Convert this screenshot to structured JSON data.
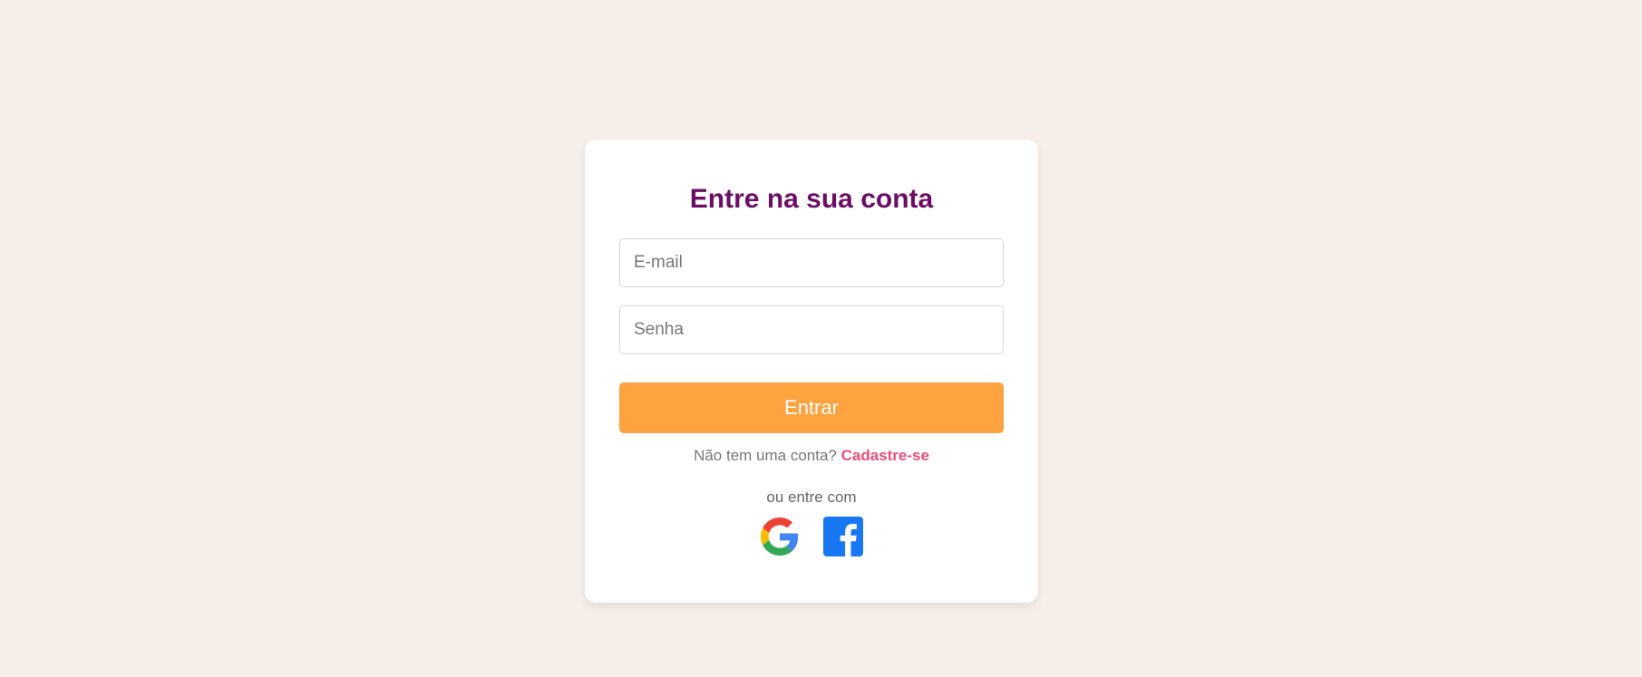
{
  "login": {
    "title": "Entre na sua conta",
    "email_placeholder": "E-mail",
    "password_placeholder": "Senha",
    "submit_label": "Entrar",
    "no_account_text": "Não tem uma conta?",
    "signup_link": "Cadastre-se",
    "or_text": "ou entre com"
  },
  "social": {
    "google_icon": "google-icon",
    "facebook_icon": "facebook-icon"
  },
  "colors": {
    "background": "#f6eee8",
    "title": "#6b0f66",
    "button": "#ffa240",
    "link": "#e8507a",
    "facebook": "#1877f2"
  }
}
